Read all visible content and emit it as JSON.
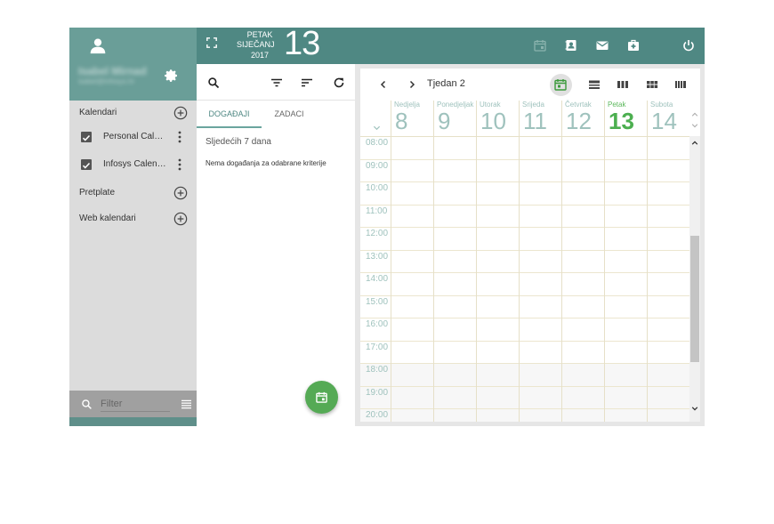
{
  "user": {
    "name": "Isabel Mirnad",
    "email": "isabel@infosys.hr"
  },
  "sidebar": {
    "sections": {
      "calendars": "Kalendari",
      "subscriptions": "Pretplate",
      "web_calendars": "Web kalendari"
    },
    "calendars": [
      {
        "name": "Personal Calen...",
        "checked": true
      },
      {
        "name": "Infosys Calend...",
        "checked": true
      }
    ],
    "filter_placeholder": "Filter"
  },
  "header": {
    "day_name": "PETAK",
    "month": "SIJEČANJ",
    "year": "2017",
    "day_number": "13"
  },
  "events_panel": {
    "tabs": [
      "DOGAĐAJI",
      "ZADACI"
    ],
    "active_tab": "DOGAĐAJI",
    "range_label": "Sljedećih 7 dana",
    "empty_message": "Nema događanja za odabrane kriterije"
  },
  "calendar": {
    "week_label": "Tjedan 2",
    "days": [
      {
        "name": "Nedjelja",
        "num": "8",
        "today": false
      },
      {
        "name": "Ponedjeljak",
        "num": "9",
        "today": false
      },
      {
        "name": "Utorak",
        "num": "10",
        "today": false
      },
      {
        "name": "Srijeda",
        "num": "11",
        "today": false
      },
      {
        "name": "Četvrtak",
        "num": "12",
        "today": false
      },
      {
        "name": "Petak",
        "num": "13",
        "today": true
      },
      {
        "name": "Subota",
        "num": "14",
        "today": false
      }
    ],
    "hours": [
      "08:00",
      "09:00",
      "10:00",
      "11:00",
      "12:00",
      "13:00",
      "14:00",
      "15:00",
      "16:00",
      "17:00",
      "18:00",
      "19:00",
      "20:00"
    ]
  },
  "colors": {
    "header_teal": "#4f8883",
    "profile_teal": "#6a9e98",
    "today_green": "#4caf50",
    "fab_green": "#55aa55"
  },
  "icons": {
    "top": [
      "fullscreen-icon",
      "calendar-add-icon",
      "contacts-icon",
      "mail-icon",
      "medical-icon",
      "power-icon"
    ],
    "events_toolbar": [
      "search-icon",
      "filter-icon",
      "sort-icon",
      "refresh-icon"
    ],
    "calendar_views": [
      "view-today-icon",
      "view-day-icon",
      "view-week-icon",
      "view-month-icon",
      "view-year-icon"
    ]
  }
}
